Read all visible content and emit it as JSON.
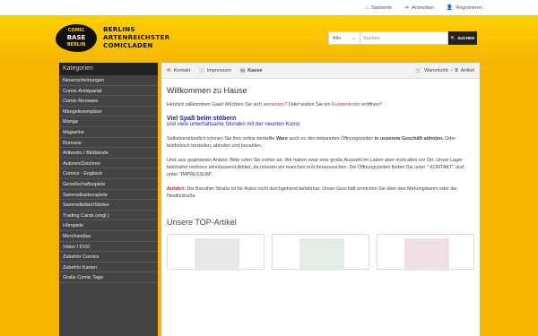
{
  "topbar": {
    "links": [
      {
        "icon": "home-icon",
        "label": "Startseite"
      },
      {
        "icon": "sign-in-icon",
        "label": "Anmelden"
      },
      {
        "icon": "user-plus-icon",
        "label": "Registrieren"
      }
    ]
  },
  "logo": {
    "line1": "COMIC",
    "line2": "BASE",
    "line3": "BERLIN"
  },
  "brand": {
    "line1": "BERLINS",
    "line2": "ARTENREICHSTER",
    "line3": "COMICLADEN"
  },
  "search": {
    "category": "Alle",
    "placeholder": "Suchen",
    "button": "SUCHEN"
  },
  "sidebar": {
    "title": "Kategorien",
    "items": [
      "Neuerscheinungen",
      "Comic-Antiquariat",
      "Comic-Neuware",
      "Mängelexemplare",
      "Manga",
      "Magazine",
      "Romane",
      "Artbooks / Bildbände",
      "Autoren/Zeichner",
      "Comics - Englisch",
      "Gesellschaftsspiele",
      "Sammelkartenspiele",
      "Sammelbilder/Sticker",
      "Trading Cards (engl.)",
      "Hörspiele",
      "Merchandise",
      "Video / DVD",
      "Zubehör Comics",
      "Zubehör Karten",
      "Gratis Comic Tage"
    ]
  },
  "navbar": {
    "kontakt": "Kontakt",
    "impressum": "Impressum",
    "kasse": "Kasse",
    "cart_label": "Warenkorb",
    "cart_sep": "›",
    "cart_count": "0",
    "cart_unit": "Artikel"
  },
  "content": {
    "title": "Willkommen zu Hause",
    "greeting_pre": "Herzlich willkommen Gast! Möchten Sie sich ",
    "greeting_link1": "anmelden",
    "greeting_mid": "? Oder wollen Sie ein ",
    "greeting_link2": "Kundenkonto",
    "greeting_post": " eröffnen?",
    "fun_line1": "Viel Spaß beim stöbern",
    "fun_line2": "und viele unterhaltsame Stunden mit der neunten Kunst",
    "p1_a": "Selbstverständlich können Sie Ihre online bestellte ",
    "p1_b": "Ware",
    "p1_c": " auch zu den bekannten Öffnungszeiten ",
    "p1_d": "in unserem Geschäft abholen.",
    "p1_e": " Oder telefonisch bestellen, abholen und bezahlen.",
    "p2": "Und, aus gegebenen Anlass: Bitte rufen Sie vorher an. Wir haben zwar eine große Auswahl im Laden aber nicht alles vor Ort. Unser Lager beinhaltet mehrere zehntausend Artikel, da müssen wir manches erst heraussuchen. Die Öffnungszeiten finden Sie unter \" KONTAKT\" und unter \"IMPRESSUM\".",
    "p3_label": "Anfahrt:",
    "p3": " Die Baruther Straße ist für Autos nicht durchgehend befahrbar. Unser Geschäft erreichen Sie über den Mehringdamm oder die Nostitzstraße.",
    "top_title": "Unsere TOP-Artikel"
  },
  "colors": {
    "accent": "#f4b400",
    "sidebar": "#444444",
    "link": "#c0306a",
    "fun": "#2020c8",
    "warn": "#e0202a"
  }
}
